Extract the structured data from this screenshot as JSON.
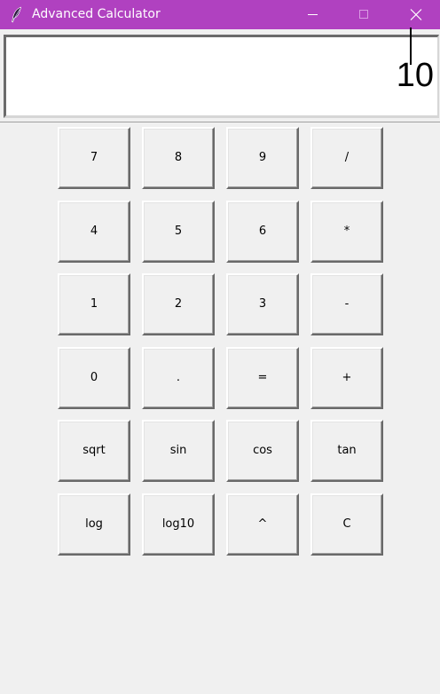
{
  "window": {
    "title": "Advanced Calculator",
    "titlebar_color": "#b041c0"
  },
  "display": {
    "value": "10"
  },
  "keypad": {
    "row1": [
      "7",
      "8",
      "9",
      "/"
    ],
    "row2": [
      "4",
      "5",
      "6",
      "*"
    ],
    "row3": [
      "1",
      "2",
      "3",
      "-"
    ],
    "row4": [
      "0",
      ".",
      "=",
      "+"
    ],
    "row5": [
      "sqrt",
      "sin",
      "cos",
      "tan"
    ],
    "row6": [
      "log",
      "log10",
      "^",
      "C"
    ]
  }
}
